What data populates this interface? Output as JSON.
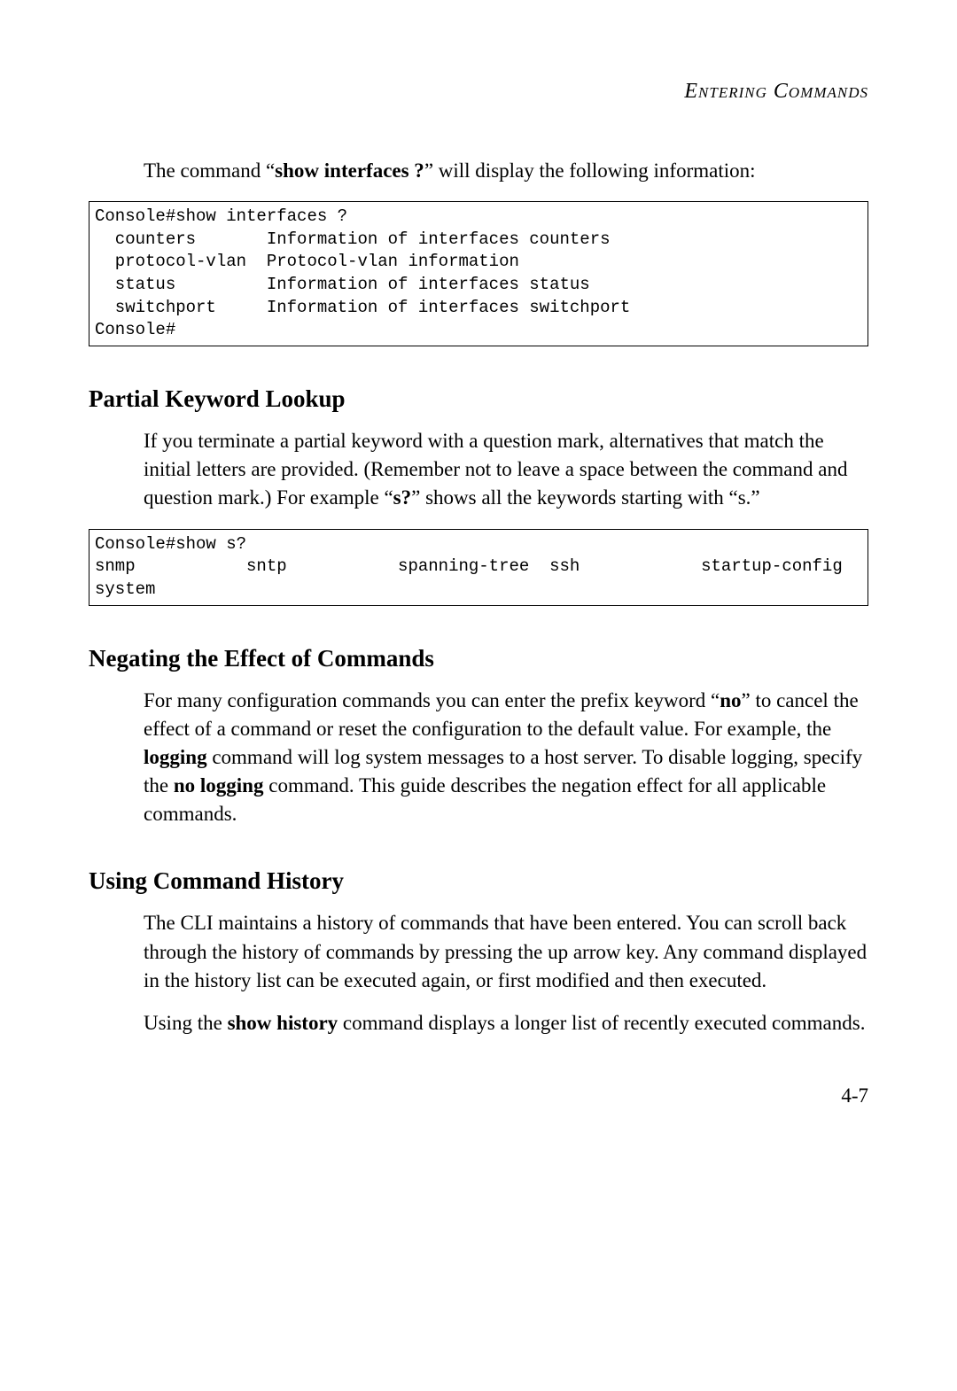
{
  "header": {
    "running": "Entering Commands"
  },
  "intro": {
    "pre": "The command “",
    "cmd": "show interfaces ?",
    "post": "” will display the following information:"
  },
  "codebox1": "Console#show interfaces ?\n  counters       Information of interfaces counters\n  protocol-vlan  Protocol-vlan information\n  status         Information of interfaces status\n  switchport     Information of interfaces switchport\nConsole#",
  "partial": {
    "heading": "Partial Keyword Lookup",
    "p1a": "If you terminate a partial keyword with a question mark, alternatives that match the initial letters are provided. (Remember not to leave a space between the command and question mark.) For example “",
    "p1b": "s?",
    "p1c": "” shows all the keywords starting with “s.”"
  },
  "codebox2": "Console#show s?\nsnmp           sntp           spanning-tree  ssh            startup-config\nsystem",
  "negating": {
    "heading": "Negating the Effect of Commands",
    "p_a": "For many configuration commands you can enter the prefix keyword “",
    "p_b": "no",
    "p_c": "” to cancel the effect of a command or reset the configuration to the default value. For example, the ",
    "p_d": "logging",
    "p_e": " command will log system messages to a host server. To disable logging, specify the ",
    "p_f": "no logging",
    "p_g": " command. This guide describes the negation effect for all applicable commands."
  },
  "history": {
    "heading": "Using Command History",
    "p1": "The CLI maintains a history of commands that have been entered. You can scroll back through the history of commands by pressing the up arrow key. Any command displayed in the history list can be executed again, or first modified and then executed.",
    "p2a": "Using the ",
    "p2b": "show history",
    "p2c": " command displays a longer list of recently executed commands."
  },
  "pagenum": "4-7"
}
